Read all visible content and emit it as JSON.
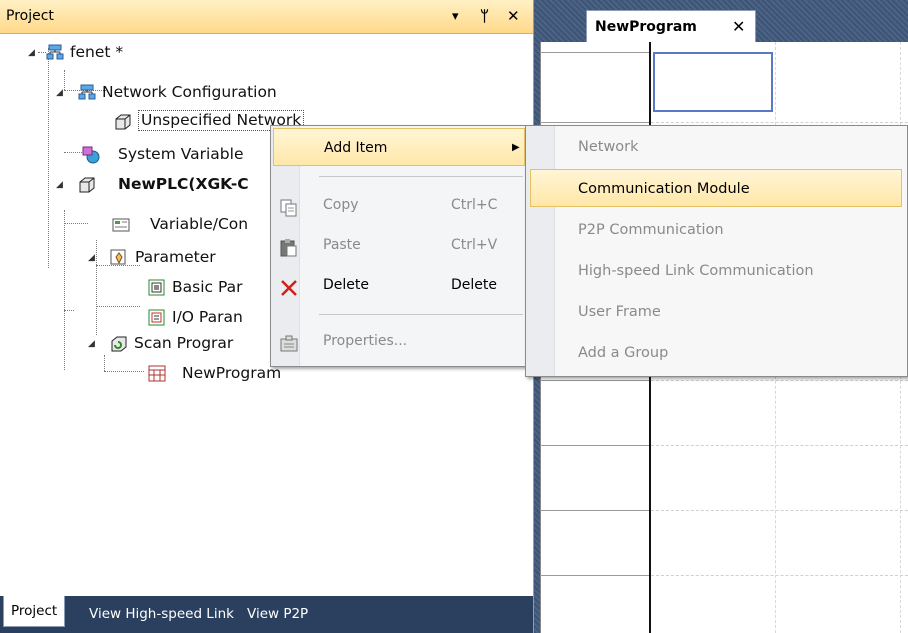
{
  "project_panel": {
    "title": "Project",
    "buttons": {
      "dropdown": "▾",
      "pin": "ᛘ",
      "close": "✕"
    },
    "tree": {
      "root": "fenet *",
      "network_config": "Network Configuration",
      "unspecified_network": "Unspecified Network",
      "system_variable": "System Variable",
      "plc": "NewPLC(XGK-C",
      "variable_comment": "Variable/Con",
      "parameter": "Parameter",
      "basic_param": "Basic Par",
      "io_param": "I/O Paran",
      "scan_program": "Scan Prograr",
      "new_program": "NewProgram"
    },
    "tabs": [
      "Project",
      "View High-speed Link",
      "View P2P"
    ]
  },
  "editor": {
    "tab_label": "NewProgram",
    "tab_close": "✕"
  },
  "context_menu": {
    "items": [
      {
        "label": "Add Item",
        "shortcut": "",
        "state": "highlighted",
        "icon": "none",
        "submenu_arrow": "▶"
      },
      {
        "label": "Copy",
        "shortcut": "Ctrl+C",
        "state": "disabled",
        "icon": "copy-icon"
      },
      {
        "label": "Paste",
        "shortcut": "Ctrl+V",
        "state": "disabled",
        "icon": "paste-icon"
      },
      {
        "label": "Delete",
        "shortcut": "Delete",
        "state": "enabled",
        "icon": "delete-icon"
      },
      {
        "label": "Properties...",
        "shortcut": "",
        "state": "disabled",
        "icon": "properties-icon"
      }
    ]
  },
  "submenu": {
    "items": [
      {
        "label": "Network",
        "state": "disabled"
      },
      {
        "label": "Communication Module",
        "state": "highlighted"
      },
      {
        "label": "P2P Communication",
        "state": "disabled"
      },
      {
        "label": "High-speed Link Communication",
        "state": "disabled"
      },
      {
        "label": "User Frame",
        "state": "disabled"
      },
      {
        "label": "Add a Group",
        "state": "disabled"
      }
    ]
  },
  "colors": {
    "highlight": "#ffe7a8",
    "header": "#ffd98a",
    "frame": "#2b3f5e",
    "delete_red": "#d0201a"
  }
}
